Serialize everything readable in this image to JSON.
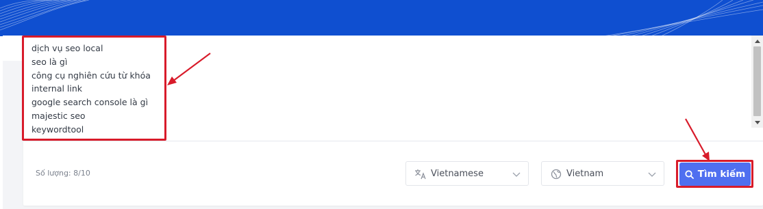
{
  "keywords": {
    "items": [
      "dịch vụ seo local",
      "seo là gì",
      "công cụ nghiên cứu từ khóa",
      "internal link",
      "google search console là gì",
      "majestic seo",
      "keywordtool"
    ]
  },
  "footer": {
    "count_label": "Số lượng: 8/10"
  },
  "language_select": {
    "value": "Vietnamese",
    "icon": "translate-icon"
  },
  "country_select": {
    "value": "Vietnam",
    "icon": "globe-icon"
  },
  "search_button": {
    "label": "Tìm kiếm",
    "icon": "search-icon"
  },
  "colors": {
    "hero_blue": "#0f4fd0",
    "button_blue": "#4f6ff0",
    "highlight_red": "#d81b2a"
  }
}
